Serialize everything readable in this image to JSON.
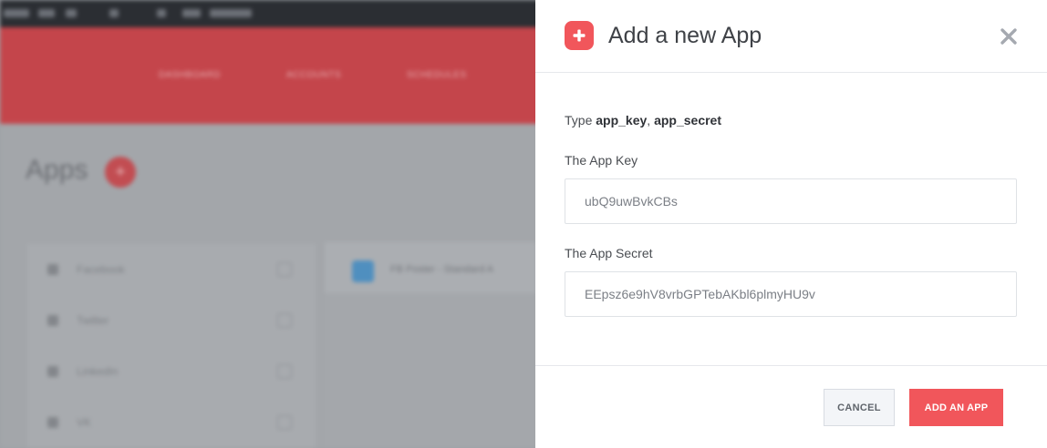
{
  "background": {
    "nav_items": [
      "DASHBOARD",
      "ACCOUNTS",
      "SCHEDULES"
    ],
    "page_title": "Apps",
    "sidebar_items": [
      {
        "label": "Facebook"
      },
      {
        "label": "Twitter"
      },
      {
        "label": "LinkedIn"
      },
      {
        "label": "VK"
      }
    ],
    "card_title": "FB Poster - Standard A"
  },
  "modal": {
    "title": "Add a new App",
    "hint_prefix": "Type ",
    "hint_key": "app_key",
    "hint_sep": ", ",
    "hint_secret": "app_secret",
    "app_key_label": "The App Key",
    "app_key_value": "ubQ9uwBvkCBs",
    "app_secret_label": "The App Secret",
    "app_secret_value": "EEpsz6e9hV8vrbGPTebAKbl6plmyHU9v",
    "cancel_label": "CANCEL",
    "add_label": "ADD AN APP"
  },
  "colors": {
    "accent": "#f1565b",
    "hero": "#c4454b"
  }
}
